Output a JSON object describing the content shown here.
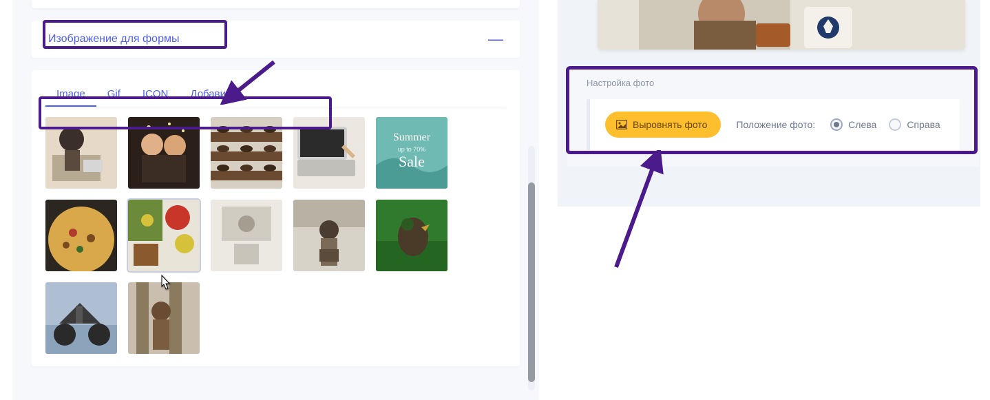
{
  "left": {
    "section_title": "Изображение для формы",
    "tabs": [
      "Image",
      "Gif",
      "ICON",
      "Добавить"
    ]
  },
  "right": {
    "settings_title": "Настройка фото",
    "align_button": "Выровнять фото",
    "position_label": "Положение фото:",
    "radio_left": "Слева",
    "radio_right": "Справа",
    "selected": "left"
  },
  "colors": {
    "accent": "#4d5ff3",
    "highlight": "#4b1b8b",
    "button": "#fdbf2d"
  }
}
